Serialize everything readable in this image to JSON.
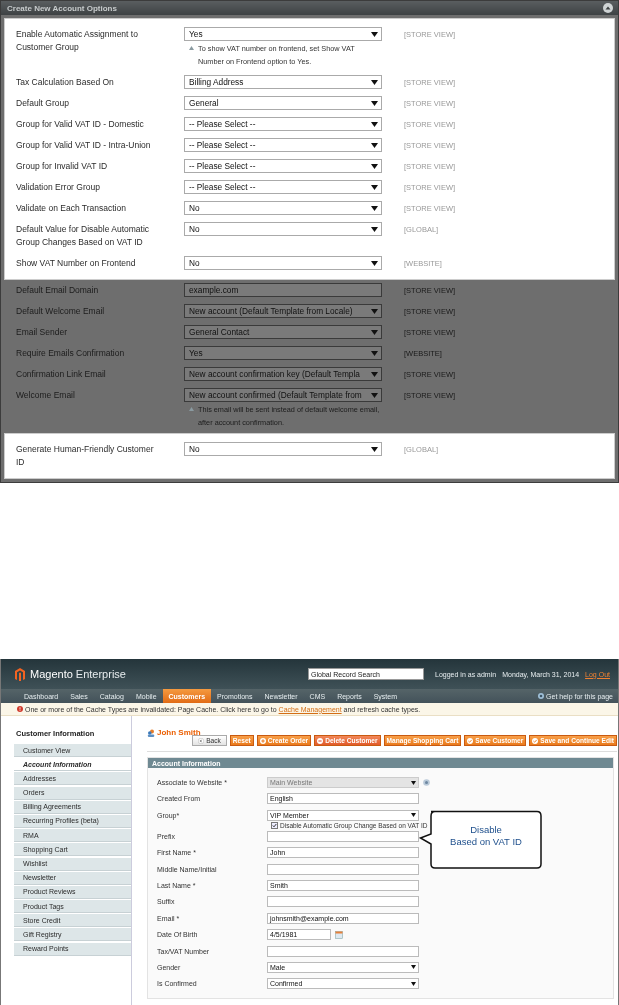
{
  "config_panel": {
    "title": "Create New Account Options",
    "rows": [
      {
        "label": "Enable Automatic Assignment to Customer Group",
        "kind": "select",
        "value": "Yes",
        "scope": "[STORE VIEW]",
        "note": "To show VAT number on frontend, set Show VAT Number on Frontend option to Yes.",
        "highlighted": true
      },
      {
        "label": "Tax Calculation Based On",
        "kind": "select",
        "value": "Billing Address",
        "scope": "[STORE VIEW]",
        "highlighted": true
      },
      {
        "label": "Default Group",
        "kind": "select",
        "value": "General",
        "scope": "[STORE VIEW]",
        "highlighted": true
      },
      {
        "label": "Group for Valid VAT ID - Domestic",
        "kind": "select",
        "value": "-- Please Select --",
        "scope": "[STORE VIEW]",
        "highlighted": true
      },
      {
        "label": "Group for Valid VAT ID - Intra-Union",
        "kind": "select",
        "value": "-- Please Select --",
        "scope": "[STORE VIEW]",
        "highlighted": true
      },
      {
        "label": "Group for Invalid VAT ID",
        "kind": "select",
        "value": "-- Please Select --",
        "scope": "[STORE VIEW]",
        "highlighted": true
      },
      {
        "label": "Validation Error Group",
        "kind": "select",
        "value": "-- Please Select --",
        "scope": "[STORE VIEW]",
        "highlighted": true
      },
      {
        "label": "Validate on Each Transaction",
        "kind": "select",
        "value": "No",
        "scope": "[STORE VIEW]",
        "highlighted": true
      },
      {
        "label": "Default Value for Disable Automatic Group Changes Based on VAT ID",
        "kind": "select",
        "value": "No",
        "scope": "[GLOBAL]",
        "highlighted": true
      },
      {
        "label": "Show VAT Number on Frontend",
        "kind": "select",
        "value": "No",
        "scope": "[WEBSITE]",
        "highlighted": true
      },
      {
        "label": "Default Email Domain",
        "kind": "text",
        "value": "example.com",
        "scope": "[STORE VIEW]",
        "highlighted": false
      },
      {
        "label": "Default Welcome Email",
        "kind": "select",
        "value": "New account (Default Template from Locale)",
        "scope": "[STORE VIEW]",
        "highlighted": false
      },
      {
        "label": "Email Sender",
        "kind": "select",
        "value": "General Contact",
        "scope": "[STORE VIEW]",
        "highlighted": false
      },
      {
        "label": "Require Emails Confirmation",
        "kind": "select",
        "value": "Yes",
        "scope": "[WEBSITE]",
        "highlighted": false
      },
      {
        "label": "Confirmation Link Email",
        "kind": "select",
        "value": "New account confirmation key (Default Templa",
        "scope": "[STORE VIEW]",
        "highlighted": false
      },
      {
        "label": "Welcome Email",
        "kind": "select",
        "value": "New account confirmed (Default Template from",
        "scope": "[STORE VIEW]",
        "note": "This email will be sent instead of default welcome email, after account confirmation.",
        "highlighted": false
      },
      {
        "label": "Generate Human-Friendly Customer ID",
        "kind": "select",
        "value": "No",
        "scope": "[GLOBAL]",
        "highlighted": true
      }
    ]
  },
  "admin_screen": {
    "logo": {
      "brand": "Magento",
      "edition": "Enterprise"
    },
    "search": {
      "placeholder": "Global Record Search"
    },
    "user": "Logged in as admin",
    "date": "Monday, March 31, 2014",
    "logout": "Log Out",
    "nav": [
      {
        "label": "Dashboard",
        "selected": false
      },
      {
        "label": "Sales",
        "selected": false
      },
      {
        "label": "Catalog",
        "selected": false
      },
      {
        "label": "Mobile",
        "selected": false
      },
      {
        "label": "Customers",
        "selected": true
      },
      {
        "label": "Promotions",
        "selected": false
      },
      {
        "label": "Newsletter",
        "selected": false
      },
      {
        "label": "CMS",
        "selected": false
      },
      {
        "label": "Reports",
        "selected": false
      },
      {
        "label": "System",
        "selected": false
      }
    ],
    "help": "Get help for this page",
    "notice": {
      "before": "One or more of the Cache Types are invalidated: Page Cache. Click here to go to",
      "link": "Cache Management",
      "after": "and refresh cache types."
    },
    "sidebar": {
      "title": "Customer Information",
      "items": [
        {
          "label": "Customer View",
          "selected": false
        },
        {
          "label": "Account Information",
          "selected": true
        },
        {
          "label": "Addresses",
          "selected": false
        },
        {
          "label": "Orders",
          "selected": false
        },
        {
          "label": "Billing Agreements",
          "selected": false
        },
        {
          "label": "Recurring Profiles (beta)",
          "selected": false
        },
        {
          "label": "RMA",
          "selected": false
        },
        {
          "label": "Shopping Cart",
          "selected": false
        },
        {
          "label": "Wishlist",
          "selected": false
        },
        {
          "label": "Newsletter",
          "selected": false
        },
        {
          "label": "Product Reviews",
          "selected": false
        },
        {
          "label": "Product Tags",
          "selected": false
        },
        {
          "label": "Store Credit",
          "selected": false
        },
        {
          "label": "Gift Registry",
          "selected": false
        },
        {
          "label": "Reward Points",
          "selected": false
        }
      ]
    },
    "page_title": "John Smith",
    "buttons": [
      {
        "label": "Back",
        "kind": "back"
      },
      {
        "label": "Reset",
        "kind": "plain"
      },
      {
        "label": "Create Order",
        "kind": "add"
      },
      {
        "label": "Delete Customer",
        "kind": "delete"
      },
      {
        "label": "Manage Shopping Cart",
        "kind": "plain"
      },
      {
        "label": "Save Customer",
        "kind": "save"
      },
      {
        "label": "Save and Continue Edit",
        "kind": "save"
      }
    ],
    "section_title": "Account Information",
    "fields": [
      {
        "label": "Associate to Website *",
        "kind": "select",
        "value": "Main Website",
        "disabled": true,
        "info_icon": true
      },
      {
        "label": "Created From",
        "kind": "text",
        "value": "English",
        "disabled": false
      },
      {
        "label": "Group*",
        "kind": "select",
        "value": "VIP Member",
        "disabled": false,
        "checkbox": {
          "label": "Disable Automatic Group Change Based on VAT ID",
          "checked": true
        }
      },
      {
        "label": "Prefix",
        "kind": "text",
        "disabled": false
      },
      {
        "label": "First Name *",
        "kind": "text",
        "value": "John",
        "disabled": false
      },
      {
        "label": "Middle Name/Initial",
        "kind": "text",
        "disabled": false
      },
      {
        "label": "Last Name *",
        "kind": "text",
        "value": "Smith",
        "disabled": false
      },
      {
        "label": "Suffix",
        "kind": "text",
        "disabled": false
      },
      {
        "label": "Email *",
        "kind": "text",
        "value": "johnsmith@example.com",
        "disabled": false
      },
      {
        "label": "Date Of Birth",
        "kind": "date",
        "value": "4/5/1981",
        "disabled": false
      },
      {
        "label": "Tax/VAT Number",
        "kind": "text",
        "disabled": false
      },
      {
        "label": "Gender",
        "kind": "select",
        "value": "Male",
        "disabled": false
      },
      {
        "label": "Is Confirmed",
        "kind": "select",
        "value": "Confirmed",
        "disabled": false
      }
    ],
    "callout": {
      "lines": [
        "Disable",
        "Based on VAT ID"
      ]
    }
  }
}
